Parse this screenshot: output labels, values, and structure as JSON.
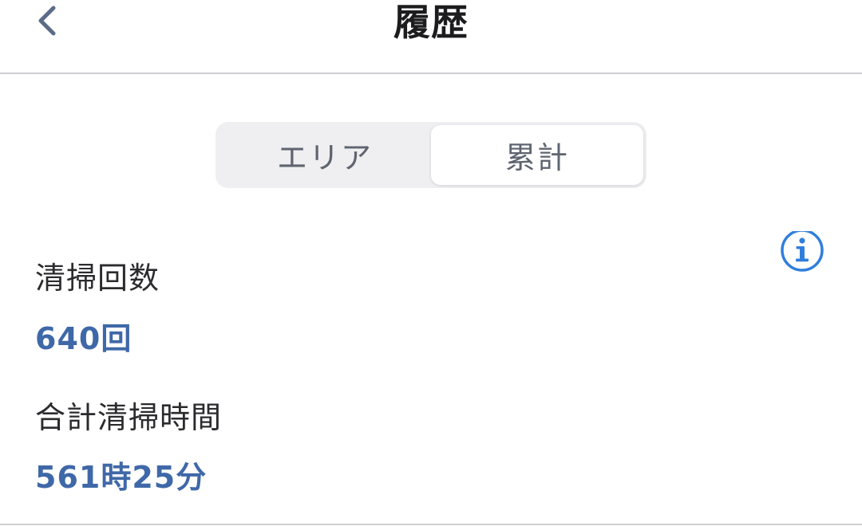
{
  "header": {
    "title": "履歴",
    "back_icon": "chevron-left-icon"
  },
  "segmented_control": {
    "segments": [
      {
        "label": "エリア",
        "selected": false
      },
      {
        "label": "累計",
        "selected": true
      }
    ]
  },
  "info_icon": "info-circle-icon",
  "stats": {
    "cleaning_count": {
      "label": "清掃回数",
      "value": "640回"
    },
    "total_cleaning_time": {
      "label": "合計清掃時間",
      "value": "561時25分"
    }
  },
  "colors": {
    "accent_blue": "#3f68a8",
    "info_blue": "#2f7fdc",
    "back_icon": "#5c6b86",
    "segment_bg": "#efeff1",
    "divider": "#cfcfd3"
  }
}
